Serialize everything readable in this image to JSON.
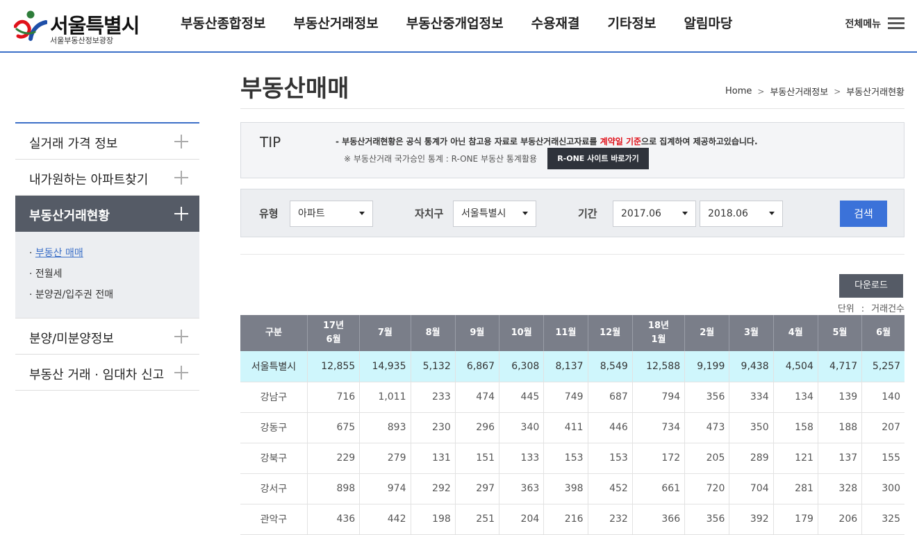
{
  "header": {
    "logo_title": "서울특별시",
    "logo_sub": "서울부동산정보광장",
    "nav": [
      "부동산종합정보",
      "부동산거래정보",
      "부동산중개업정보",
      "수용재결",
      "기타정보",
      "알림마당"
    ],
    "all_menu": "전체메뉴"
  },
  "sidebar": {
    "items": [
      {
        "label": "실거래 가격 정보"
      },
      {
        "label": "내가원하는 아파트찾기"
      },
      {
        "label": "부동산거래현황"
      },
      {
        "label": "분양/미분양정보"
      },
      {
        "label": "부동산 거래 · 임대차 신고"
      }
    ],
    "sub_items": [
      "부동산 매매",
      "전월세",
      "분양권/입주권 전매"
    ]
  },
  "page": {
    "title": "부동산매매",
    "breadcrumb": [
      "Home",
      "부동산거래정보",
      "부동산거래현황"
    ]
  },
  "tip": {
    "label": "TIP",
    "line1_prefix": "-  부동산거래현황은 공식 통계가 아닌 참고용 자료로 부동산거래신고자료를 ",
    "line1_highlight": "계약일 기준",
    "line1_suffix": "으로 집계하여 제공하고있습니다.",
    "line2": "※ 부동산거래 국가승인 통계 : R-ONE 부동산 통계활용",
    "rone_button": "R-ONE 사이트 바로가기"
  },
  "search": {
    "type_label": "유형",
    "type_value": "아파트",
    "district_label": "자치구",
    "district_value": "서울특별시",
    "period_label": "기간",
    "period_from": "2017.06",
    "period_to": "2018.06",
    "button": "검색"
  },
  "download_button": "다운로드",
  "unit": {
    "label": "단위",
    "colon": ":",
    "value": "거래건수"
  },
  "table": {
    "headers": [
      {
        "l1": "구분",
        "l2": ""
      },
      {
        "l1": "17년",
        "l2": "6월"
      },
      {
        "l1": "7월",
        "l2": ""
      },
      {
        "l1": "8월",
        "l2": ""
      },
      {
        "l1": "9월",
        "l2": ""
      },
      {
        "l1": "10월",
        "l2": ""
      },
      {
        "l1": "11월",
        "l2": ""
      },
      {
        "l1": "12월",
        "l2": ""
      },
      {
        "l1": "18년",
        "l2": "1월"
      },
      {
        "l1": "2월",
        "l2": ""
      },
      {
        "l1": "3월",
        "l2": ""
      },
      {
        "l1": "4월",
        "l2": ""
      },
      {
        "l1": "5월",
        "l2": ""
      },
      {
        "l1": "6월",
        "l2": ""
      }
    ],
    "rows": [
      [
        "서울특별시",
        "12,855",
        "14,935",
        "5,132",
        "6,867",
        "6,308",
        "8,137",
        "8,549",
        "12,588",
        "9,199",
        "9,438",
        "4,504",
        "4,717",
        "5,257"
      ],
      [
        "강남구",
        "716",
        "1,011",
        "233",
        "474",
        "445",
        "749",
        "687",
        "794",
        "356",
        "334",
        "134",
        "139",
        "140"
      ],
      [
        "강동구",
        "675",
        "893",
        "230",
        "296",
        "340",
        "411",
        "446",
        "734",
        "473",
        "350",
        "158",
        "188",
        "207"
      ],
      [
        "강북구",
        "229",
        "279",
        "131",
        "151",
        "133",
        "153",
        "153",
        "172",
        "205",
        "289",
        "121",
        "137",
        "155"
      ],
      [
        "강서구",
        "898",
        "974",
        "292",
        "297",
        "363",
        "398",
        "452",
        "661",
        "720",
        "704",
        "281",
        "328",
        "300"
      ],
      [
        "관악구",
        "436",
        "442",
        "198",
        "251",
        "204",
        "216",
        "232",
        "366",
        "356",
        "392",
        "179",
        "206",
        "325"
      ]
    ]
  },
  "colors": {
    "accent": "#3b6fc7",
    "highlight_row": "#cff6fc",
    "header_bg": "#7a7e89",
    "red": "#e0121b"
  }
}
